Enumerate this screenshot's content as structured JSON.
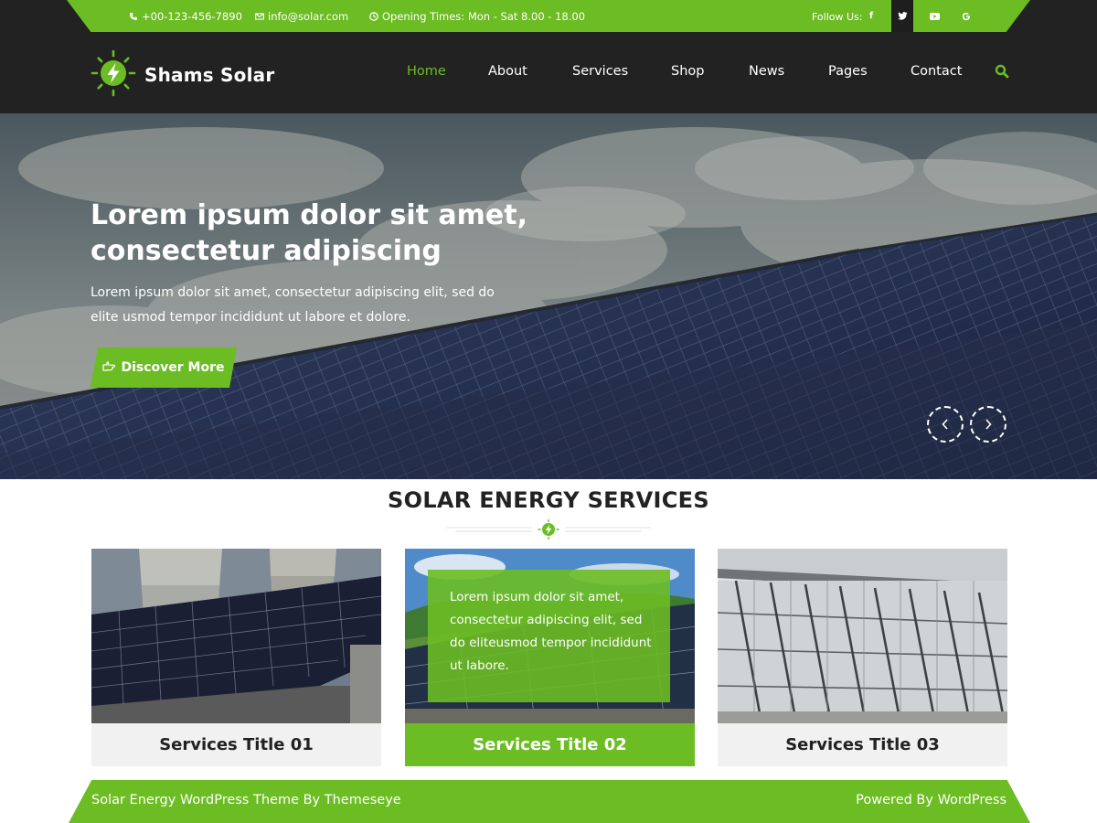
{
  "topbar": {
    "phone": "+00-123-456-7890",
    "email": "info@solar.com",
    "hours": "Opening Times: Mon - Sat 8.00 - 18.00",
    "follow_label": "Follow Us:",
    "socials": [
      "facebook-icon",
      "twitter-icon",
      "youtube-icon",
      "google-icon"
    ]
  },
  "brand": {
    "name": "Shams Solar",
    "accent": "#6cbc23",
    "dark": "#222222"
  },
  "nav": {
    "items": [
      "Home",
      "About",
      "Services",
      "Shop",
      "News",
      "Pages",
      "Contact"
    ],
    "active": "Home"
  },
  "hero": {
    "title": "Lorem ipsum dolor sit amet, consectetur adipiscing",
    "text": "Lorem ipsum dolor sit amet, consectetur adipiscing elit, sed do elite usmod tempor incididunt ut labore et dolore.",
    "button": "Discover More"
  },
  "services": {
    "heading": "SOLAR ENERGY SERVICES",
    "cards": [
      {
        "title": "Services Title 01"
      },
      {
        "title": "Services Title 02",
        "overlay": "Lorem ipsum dolor sit amet, consectetur adipiscing elit, sed do eliteusmod tempor incididunt ut labore."
      },
      {
        "title": "Services Title 03"
      }
    ]
  },
  "footer": {
    "left": "Solar Energy WordPress Theme By Themeseye",
    "right": "Powered By WordPress"
  }
}
